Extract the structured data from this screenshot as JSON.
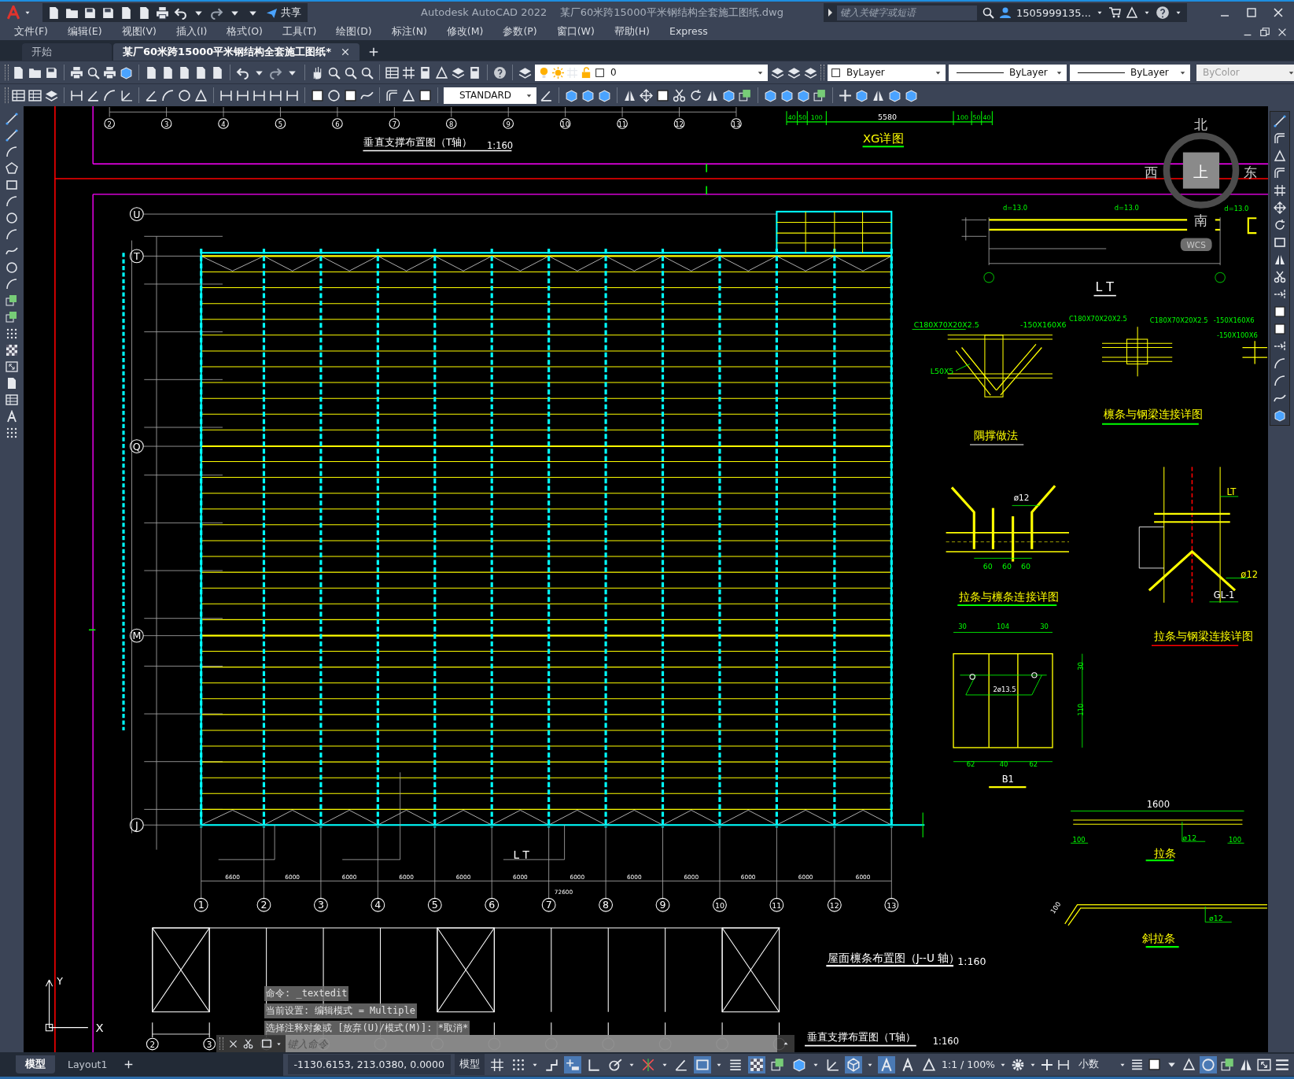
{
  "title_bar": {
    "app": "Autodesk AutoCAD 2022",
    "file": "某厂60米跨15000平米钢结构全套施工图纸.dwg",
    "share": "共享",
    "search": {
      "placeholder": "键入关键字或短语"
    },
    "user": "1505999135..."
  },
  "menu": [
    "文件(F)",
    "编辑(E)",
    "视图(V)",
    "插入(I)",
    "格式(O)",
    "工具(T)",
    "绘图(D)",
    "标注(N)",
    "修改(M)",
    "参数(P)",
    "窗口(W)",
    "帮助(H)",
    "Express"
  ],
  "tabs": [
    {
      "label": "开始",
      "selected": false
    },
    {
      "label": "某厂60米跨15000平米钢结构全套施工图纸*",
      "selected": true
    }
  ],
  "toolbar_1": {
    "layer": "0",
    "color_control": "ByLayer",
    "linetype": "ByLayer",
    "lineweight": "ByLayer",
    "plot_style": {
      "label": "ByColor",
      "disabled": true
    }
  },
  "toolbar_2": {
    "text_style": "STANDARD"
  },
  "drawing": {
    "top_axes": [
      "2",
      "3",
      "4",
      "5",
      "6",
      "7",
      "8",
      "9",
      "10",
      "11",
      "12",
      "13"
    ],
    "top_title": "垂直支撑布置图（T轴）",
    "top_scale": "1:160",
    "xg_dims": [
      "40",
      "50",
      "100",
      "5580",
      "100",
      "50",
      "40"
    ],
    "xg_title": "XG详图",
    "compass": {
      "north": "北",
      "west": "西",
      "east": "东",
      "south": "南",
      "top": "上",
      "ucs": "WCS"
    },
    "plan": {
      "row_axes": [
        "U",
        "T",
        "Q",
        "M",
        "J"
      ],
      "column_axes": [
        "1",
        "2",
        "3",
        "4",
        "5",
        "6",
        "7",
        "8",
        "9",
        "10",
        "11",
        "12",
        "13"
      ],
      "bay_dims": [
        "6600",
        "6000",
        "6000",
        "6000",
        "6000",
        "6000",
        "6000",
        "6000",
        "6000",
        "6000",
        "6000",
        "6000"
      ],
      "total_dim": "72600",
      "callout": "L T",
      "title": "屋面檩条布置图（J--U 轴）",
      "scale": "1:160"
    },
    "details": [
      {
        "title": "L T",
        "labels": [
          "d=13.0",
          "d=13.0",
          "d=13.0"
        ]
      },
      {
        "title": "隅撑做法",
        "labels": [
          "C180X70X20X2.5",
          "-150X160X6",
          "L50X5"
        ]
      },
      {
        "title": "檩条与钢梁连接详图",
        "labels": [
          "C180X70X20X2.5",
          "C180X70X20X2.5",
          "-150X160X6",
          "-150X100X6"
        ]
      },
      {
        "title": "拉条与檩条连接详图",
        "labels": [
          "ø12",
          "60",
          "60",
          "60"
        ]
      },
      {
        "title": "拉条与钢梁连接详图",
        "labels": [
          "LT",
          "ø12",
          "GL-1"
        ]
      },
      {
        "title": "B1",
        "labels": [
          "30",
          "104",
          "30",
          "2ø13.5",
          "62",
          "40",
          "62",
          "30",
          "110"
        ]
      },
      {
        "title": "拉条",
        "labels": [
          "1600",
          "100",
          "ø12",
          "100"
        ]
      },
      {
        "title": "斜拉条",
        "labels": [
          "100",
          "ø12"
        ]
      }
    ],
    "elevation": {
      "axes": [
        "2",
        "3"
      ],
      "title": "垂直支撑布置图（T轴）",
      "scale": "1:160"
    },
    "ucs": {
      "x": "X",
      "y": "Y"
    }
  },
  "command_line": {
    "history": [
      "命令: _textedit",
      "当前设置: 编辑模式 = Multiple",
      "选择注释对象或 [放弃(U)/模式(M)]: *取消*"
    ],
    "placeholder": "键入命令"
  },
  "layout_tabs": [
    {
      "label": "模型",
      "selected": true
    },
    {
      "label": "Layout1",
      "selected": false
    }
  ],
  "status_bar": {
    "coordinates": "-1130.6153, 213.0380, 0.0000",
    "space": "模型",
    "toggles": [
      {
        "kind": "grid",
        "on": false
      },
      {
        "kind": "snap",
        "on": false
      },
      {
        "kind": "infer",
        "on": false
      },
      {
        "kind": "dynamic_input",
        "on": true
      },
      {
        "kind": "ortho",
        "on": false
      },
      {
        "kind": "polar",
        "on": false
      },
      {
        "kind": "isodraft",
        "on": false
      },
      {
        "kind": "tracking",
        "on": false
      },
      {
        "kind": "osnap",
        "on": true
      },
      {
        "kind": "lineweight",
        "on": false
      },
      {
        "kind": "transparency",
        "on": true
      },
      {
        "kind": "cycling",
        "on": false
      },
      {
        "kind": "osnap3d",
        "on": false
      },
      {
        "kind": "ucs",
        "on": false
      },
      {
        "kind": "gizmo",
        "on": true
      },
      {
        "kind": "annotation",
        "on": true
      },
      {
        "kind": "autoscale",
        "on": false
      },
      {
        "kind": "annoscale",
        "on": false
      }
    ],
    "scale": "1:1 / 100%",
    "units": "小数",
    "isolate_on": true
  }
}
